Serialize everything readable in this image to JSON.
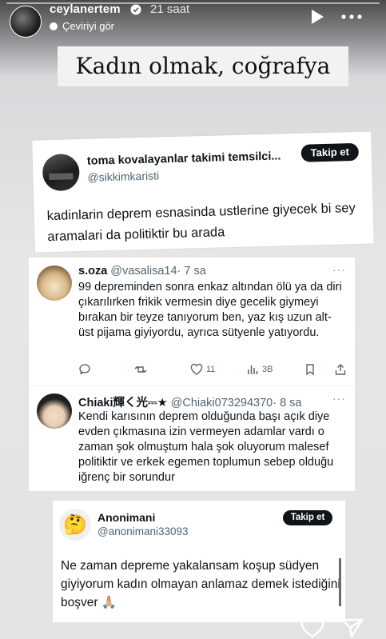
{
  "story": {
    "username": "ceylanertem",
    "time_ago": "21 saat",
    "translate_label": "Çeviriyi gör"
  },
  "title": "Kadın olmak, coğrafya",
  "tweet_main": {
    "name": "toma kovalayanlar takimi temsilci...",
    "handle": "@sikkimkaristi",
    "follow_label": "Takip et",
    "text": "kadinlarin deprem esnasinda ustlerine giyecek bi sey aramalari da politiktir bu arada"
  },
  "replies": [
    {
      "name": "s.oza",
      "handle": "@vasalisa14",
      "time": "· 7 sa",
      "more": "···",
      "text": "99 depreminden sonra enkaz altından ölü ya da diri çıkarılırken frikik vermesin diye gecelik giymeyi bırakan bir teyze tanıyorum ben, yaz kış uzun alt-üst pijama giyiyordu, ayrıca sütyenle yatıyordu.",
      "likes": "11",
      "views": "3B"
    },
    {
      "name": "Chiaki輝く光⎓★",
      "handle": "@Chiaki073294370",
      "time": "· 8 sa",
      "more": "···",
      "text": "Kendi karısının deprem olduğunda başı açık diye evden çıkmasına izin vermeyen adamlar vardı o zaman şok olmuştum hala şok oluyorum malesef politiktir ve erkek egemen toplumun sebep olduğu iğrenç bir sorundur"
    }
  ],
  "tweet_third": {
    "name": "Anonimani",
    "handle": "@anonimani33093",
    "follow_label": "Takip et",
    "text": "Ne zaman depreme yakalansam koşup südyen giyiyorum kadın olmayan anlamaz demek istediğini boşver 🙏🏼"
  },
  "colors": {
    "text_primary": "#0f1419",
    "text_secondary": "#536471",
    "follow_bg": "#0f1419"
  }
}
